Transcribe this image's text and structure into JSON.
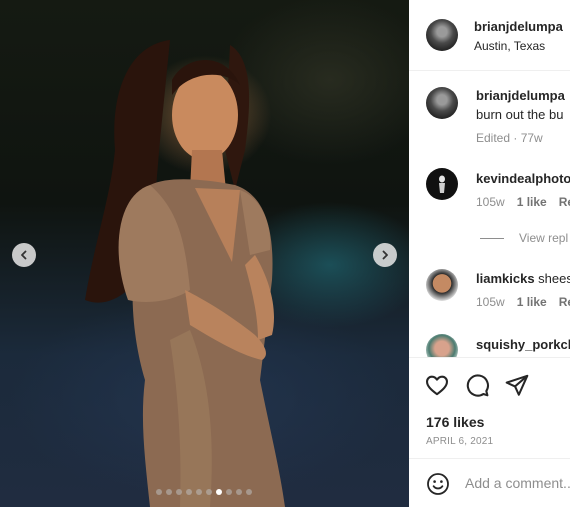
{
  "post": {
    "owner": {
      "username": "brianjdelumpa",
      "location": "Austin, Texas",
      "avatar_icon": "profile-photo"
    },
    "photo": {
      "carousel_count": 10,
      "carousel_index": 6,
      "prev_icon": "chevron-left-icon",
      "next_icon": "chevron-right-icon"
    }
  },
  "comments": [
    {
      "username": "brianjdelumpa",
      "text": "burn out the bu",
      "meta": [
        "Edited · 77w"
      ]
    },
    {
      "username": "kevindealphoto",
      "text": "",
      "meta": [
        "105w",
        "1 like",
        "Rep"
      ]
    },
    {
      "view_replies": "View repl"
    },
    {
      "username": "liamkicks",
      "text": "shees",
      "meta": [
        "105w",
        "1 like",
        "Rep"
      ]
    },
    {
      "username": "squishy_porkch",
      "text": ""
    }
  ],
  "actions": {
    "icons": [
      "heart-icon",
      "comment-icon",
      "share-icon"
    ],
    "likes": "176 likes",
    "date": "APRIL 6, 2021"
  },
  "add_comment": {
    "placeholder": "Add a comment...",
    "emoji_icon": "emoji-icon"
  },
  "colors": {
    "text": "#262626",
    "muted": "#8e8e8e",
    "divider": "#efefef"
  }
}
